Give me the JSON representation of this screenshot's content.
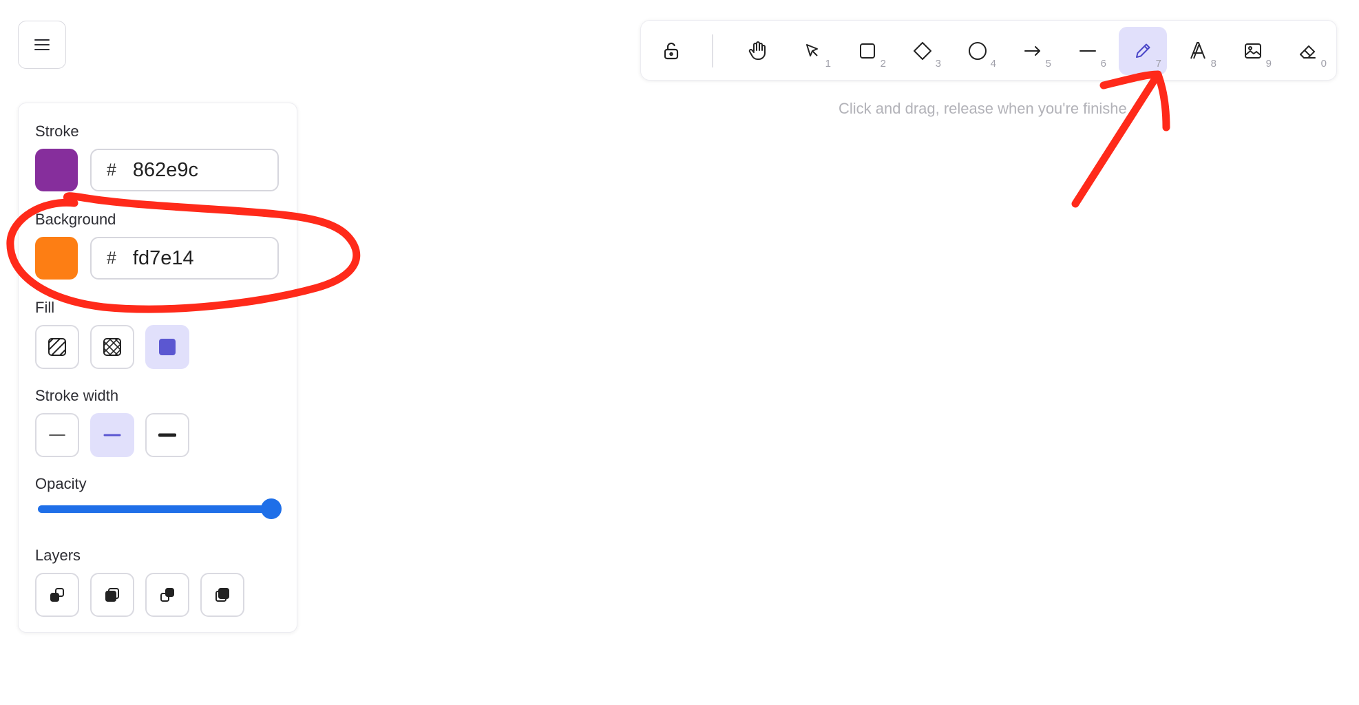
{
  "menu": {
    "icon": "hamburger-menu-icon"
  },
  "panel": {
    "stroke": {
      "label": "Stroke",
      "hash": "#",
      "value": "862e9c",
      "color": "#862e9c"
    },
    "background": {
      "label": "Background",
      "hash": "#",
      "value": "fd7e14",
      "color": "#fd7e14"
    },
    "fill": {
      "label": "Fill",
      "options": [
        {
          "icon": "hatch-fill-icon",
          "active": false
        },
        {
          "icon": "cross-hatch-fill-icon",
          "active": false
        },
        {
          "icon": "solid-fill-icon",
          "active": true
        }
      ]
    },
    "stroke_width": {
      "label": "Stroke width",
      "options": [
        {
          "icon": "thin-line-icon",
          "active": false
        },
        {
          "icon": "medium-line-icon",
          "active": true
        },
        {
          "icon": "thick-line-icon",
          "active": false
        }
      ]
    },
    "opacity": {
      "label": "Opacity",
      "value_percent": 100
    },
    "layers": {
      "label": "Layers",
      "options": [
        "send-to-back-icon",
        "send-backward-icon",
        "bring-forward-icon",
        "bring-to-front-icon"
      ]
    }
  },
  "toolbar": {
    "tools": [
      {
        "name": "lock",
        "icon": "unlock-icon",
        "key": ""
      },
      {
        "name": "hand",
        "icon": "hand-icon",
        "key": ""
      },
      {
        "name": "selection",
        "icon": "pointer-icon",
        "key": "1"
      },
      {
        "name": "rectangle",
        "icon": "rectangle-icon",
        "key": "2"
      },
      {
        "name": "diamond",
        "icon": "diamond-icon",
        "key": "3"
      },
      {
        "name": "ellipse",
        "icon": "ellipse-icon",
        "key": "4"
      },
      {
        "name": "arrow",
        "icon": "arrow-icon",
        "key": "5"
      },
      {
        "name": "line",
        "icon": "line-icon",
        "key": "6"
      },
      {
        "name": "draw",
        "icon": "pencil-icon",
        "key": "7",
        "active": true
      },
      {
        "name": "text",
        "icon": "text-icon",
        "key": "8"
      },
      {
        "name": "image",
        "icon": "image-icon",
        "key": "9"
      },
      {
        "name": "eraser",
        "icon": "eraser-icon",
        "key": "0"
      }
    ]
  },
  "hint": "Click and drag, release when you're finishe",
  "colors": {
    "accent": "#6965db",
    "active_bg": "#e1e0fb",
    "slider": "#1f6fe8",
    "annotation": "#ff2a1a"
  }
}
